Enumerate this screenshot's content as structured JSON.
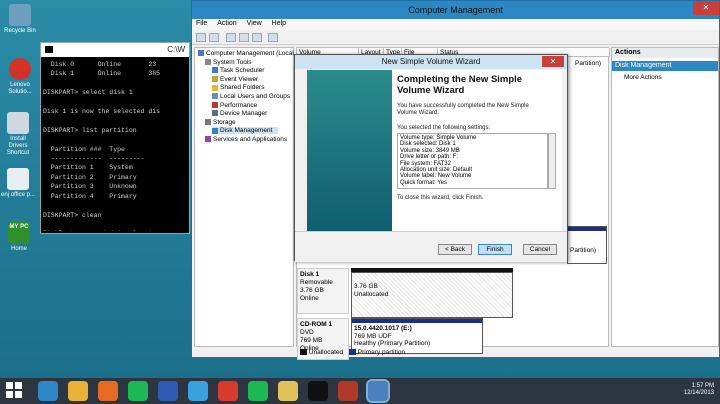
{
  "desktop": {
    "icons": [
      {
        "label": "Recycle Bin",
        "icon": "recycle-bin-icon",
        "color": "#6f9fbf"
      },
      {
        "label": "Lenovo Solutio...",
        "icon": "lenovo-icon",
        "color": "#d3322b"
      },
      {
        "label": "Install Drivers Shortcut",
        "icon": "drivers-icon",
        "color": "#cfd7df"
      },
      {
        "label": "enj office p...",
        "icon": "office-icon",
        "color": "#e7eef3"
      },
      {
        "label": "Home",
        "icon": "my-pc-icon",
        "color": "#2f8f2f"
      }
    ],
    "mypc_text": "MY PC"
  },
  "cmd": {
    "title": "C:\\W",
    "lines": [
      "  Disk 0      Online       23",
      "  Disk 1      Online       385",
      "",
      "DISKPART> select disk 1",
      "",
      "Disk 1 is now the selected dis",
      "",
      "DISKPART> list partition",
      "",
      "  Partition ###  Type",
      "  -------------  ---------",
      "  Partition 1    System",
      "  Partition 2    Primary",
      "  Partition 3    Unknown",
      "  Partition 4    Primary",
      "",
      "DISKPART> clean",
      "",
      "DiskPart succeeded in cleaning",
      "",
      "DISKPART> list partition",
      "",
      "There are no partitions on thi",
      "",
      "DISKPART> "
    ]
  },
  "cm": {
    "title": "Computer Management",
    "menu": [
      "File",
      "Action",
      "View",
      "Help"
    ],
    "tree": [
      {
        "label": "Computer Management (Local",
        "indent": 0,
        "icon": "computer-icon"
      },
      {
        "label": "System Tools",
        "indent": 1,
        "icon": "tools-icon"
      },
      {
        "label": "Task Scheduler",
        "indent": 2,
        "icon": "clock-icon"
      },
      {
        "label": "Event Viewer",
        "indent": 2,
        "icon": "event-icon"
      },
      {
        "label": "Shared Folders",
        "indent": 2,
        "icon": "folder-icon"
      },
      {
        "label": "Local Users and Groups",
        "indent": 2,
        "icon": "users-icon"
      },
      {
        "label": "Performance",
        "indent": 2,
        "icon": "performance-icon"
      },
      {
        "label": "Device Manager",
        "indent": 2,
        "icon": "device-icon"
      },
      {
        "label": "Storage",
        "indent": 1,
        "icon": "storage-icon"
      },
      {
        "label": "Disk Management",
        "indent": 2,
        "icon": "disk-icon"
      },
      {
        "label": "Services and Applications",
        "indent": 1,
        "icon": "services-icon"
      }
    ],
    "columns": [
      "Volume",
      "Layout",
      "Type",
      "File System",
      "Status"
    ],
    "partition_fragments": [
      "Partition)",
      "Partition)"
    ],
    "actions": {
      "header": "Actions",
      "selected": "Disk Management",
      "more": "More Actions"
    },
    "disks": [
      {
        "name": "Disk 1",
        "type": "Removable",
        "size": "3.76 GB",
        "status": "Online",
        "part_size": "3.76 GB",
        "part_status": "Unallocated"
      },
      {
        "name": "CD-ROM 1",
        "type": "DVD",
        "size": "769 MB",
        "status": "Online",
        "part_name": "15.0.4420.1017 (E:)",
        "part_size": "769 MB UDF",
        "part_status": "Healthy (Primary Partition)"
      }
    ],
    "legend": [
      "Unallocated",
      "Primary partition"
    ],
    "colors": {
      "unallocated": "#111111",
      "primary": "#1c2d8a"
    }
  },
  "wizard": {
    "title": "New Simple Volume Wizard",
    "heading": "Completing the New Simple Volume Wizard",
    "intro": "You have successfully completed the New Simple Volume Wizard.",
    "settings_label": "You selected the following settings:",
    "settings": [
      "Volume type: Simple Volume",
      "Disk selected: Disk 1",
      "Volume size: 3849 MB",
      "Drive letter or path: F:",
      "File system: FAT32",
      "Allocation unit size: Default",
      "Volume label: New Volume",
      "Quick format: Yes"
    ],
    "close_text": "To close this wizard, click Finish.",
    "back": "< Back",
    "finish": "Finish",
    "cancel": "Cancel"
  },
  "taskbar": {
    "time": "1:57 PM",
    "date": "12/14/2013",
    "apps": [
      "ie-icon",
      "chrome-icon",
      "firefox-icon",
      "spotify-icon",
      "photoshop-icon",
      "messenger-icon",
      "gmail-icon",
      "spotify-icon",
      "explorer-icon",
      "cmd-icon",
      "filezilla-icon",
      "computer-management-icon"
    ]
  }
}
